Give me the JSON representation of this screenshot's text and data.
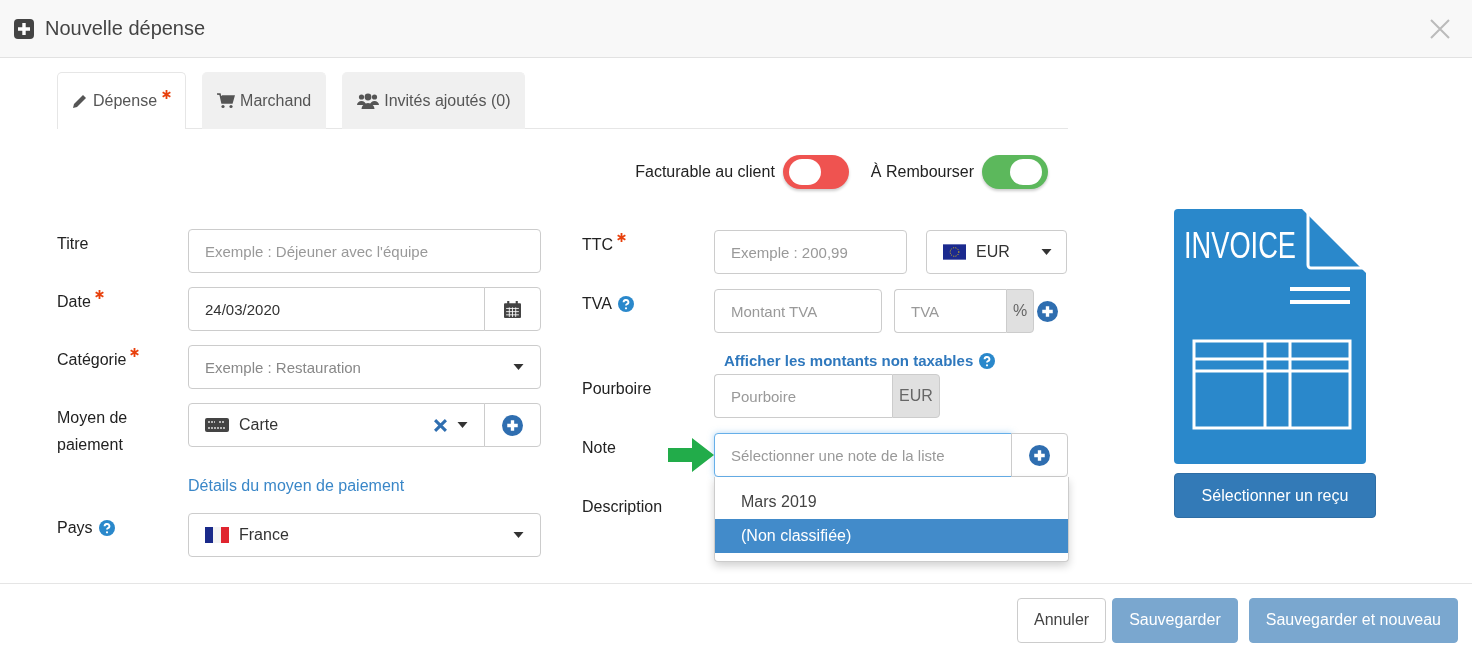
{
  "window": {
    "title": "Nouvelle dépense"
  },
  "tabs": [
    {
      "label": "Dépense",
      "kind": "edit",
      "required": true,
      "selected": true
    },
    {
      "label": "Marchand",
      "kind": "cart",
      "required": false,
      "selected": false
    },
    {
      "label": "Invités ajoutés (0)",
      "kind": "group",
      "required": false,
      "selected": false
    }
  ],
  "toggles": [
    {
      "label": "Facturable au client",
      "on": false
    },
    {
      "label": "À Rembourser",
      "on": true
    }
  ],
  "left_fields": [
    {
      "kind": "text",
      "label": "Titre",
      "required": false,
      "placeholder": "Exemple : Déjeuner avec l'équipe"
    },
    {
      "kind": "date",
      "label": "Date",
      "required": true,
      "value": "24/03/2020"
    },
    {
      "kind": "select",
      "label": "Catégorie",
      "required": true,
      "placeholder": "Exemple : Restauration"
    },
    {
      "kind": "payment",
      "label": "Moyen de paiement",
      "required": false,
      "value": "Carte"
    },
    {
      "kind": "link",
      "text": "Détails du moyen de paiement",
      "help": false
    },
    {
      "kind": "country",
      "label": "Pays",
      "help": true,
      "value": "France"
    }
  ],
  "right_fields": [
    {
      "kind": "amount",
      "label": "TTC",
      "required": true,
      "placeholder": "Exemple : 200,99",
      "currency": "EUR"
    },
    {
      "kind": "vat",
      "label": "TVA",
      "help": true,
      "placeholder": "Montant TVA",
      "rate_placeholder": "TVA",
      "addon": "%"
    },
    {
      "kind": "link",
      "text": "Afficher les montants non taxables",
      "help": true
    },
    {
      "kind": "addon",
      "label": "Pourboire",
      "placeholder": "Pourboire",
      "addon": "EUR"
    },
    {
      "kind": "note",
      "label": "Note",
      "focused": true,
      "placeholder": "Sélectionner une note de la liste",
      "options": [
        {
          "label": "Mars 2019",
          "selected": false
        },
        {
          "label": "(Non classifiée)",
          "selected": true
        }
      ]
    },
    {
      "kind": "covered",
      "label": "Description"
    }
  ],
  "receipt": {
    "image_text": "INVOICE",
    "button": "Sélectionner un reçu"
  },
  "footer_buttons": [
    {
      "label": "Annuler",
      "kind": "default",
      "disabled": false
    },
    {
      "label": "Sauvegarder",
      "kind": "primary",
      "disabled": true
    },
    {
      "label": "Sauvegarder et nouveau",
      "kind": "primary",
      "disabled": true
    }
  ]
}
